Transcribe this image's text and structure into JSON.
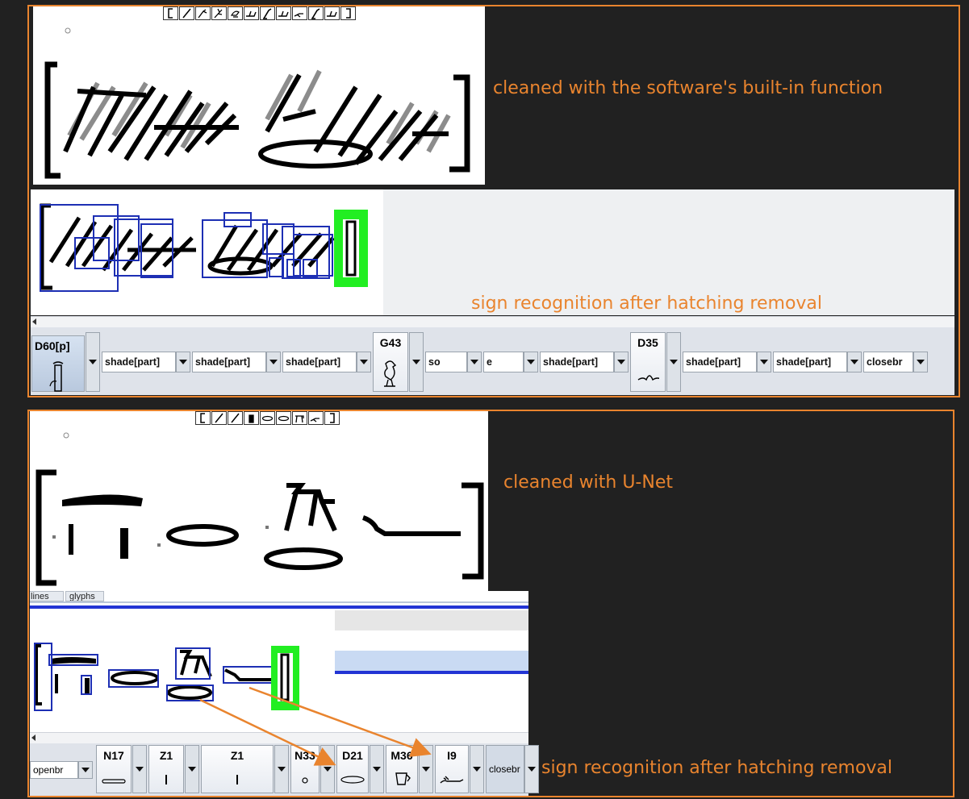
{
  "captions": {
    "top_cleaned": "cleaned with the software's built-in function",
    "top_recognition": "sign recognition after hatching removal",
    "bottom_cleaned": "cleaned with U-Net",
    "bottom_recognition": "sign recognition after hatching removal"
  },
  "colors": {
    "accent": "#e9842e",
    "background": "#212121",
    "box_blue": "#1d2fb4",
    "box_green": "#22ee22"
  },
  "top_panel": {
    "glyph_bar_icons": [
      "bracket-open-icon",
      "stroke-icon",
      "hand-icon",
      "flower-icon",
      "bird-icon",
      "arm-icon",
      "leg-icon",
      "arm-icon",
      "snake-icon",
      "leg-icon",
      "arm-icon",
      "bracket-close-icon"
    ],
    "sign_strip": [
      {
        "kind": "sign",
        "code": "D60[p]",
        "icon": "vase-water-icon",
        "selected": true
      },
      {
        "kind": "select",
        "label": "shade[part]"
      },
      {
        "kind": "select",
        "label": "shade[part]"
      },
      {
        "kind": "select",
        "label": "shade[part]"
      },
      {
        "kind": "sign",
        "code": "G43",
        "icon": "quail-chick-icon"
      },
      {
        "kind": "select",
        "label": "so"
      },
      {
        "kind": "select",
        "label": "e"
      },
      {
        "kind": "select",
        "label": "shade[part]"
      },
      {
        "kind": "sign",
        "code": "D35",
        "icon": "arms-negation-icon"
      },
      {
        "kind": "select",
        "label": "shade[part]"
      },
      {
        "kind": "select",
        "label": "shade[part]"
      },
      {
        "kind": "select",
        "label": "closebr"
      }
    ]
  },
  "bottom_panel": {
    "glyph_bar_icons": [
      "bracket-open-icon",
      "stroke-icon",
      "stroke-icon",
      "vase-icon",
      "mouth-icon",
      "mouth-icon",
      "stool-icon",
      "snake-icon",
      "bracket-close-icon"
    ],
    "tabs": [
      "lines",
      "glyphs"
    ],
    "sign_strip": {
      "openbr": "openbr",
      "signs": [
        {
          "code": "N17",
          "icon": "land-strip-icon"
        },
        {
          "code": "Z1",
          "icon": "stroke-icon"
        },
        {
          "code": "Z1",
          "icon": "stroke-icon"
        },
        {
          "code": "N33",
          "icon": "grain-icon"
        },
        {
          "code": "D21",
          "icon": "mouth-icon"
        },
        {
          "code": "M36",
          "icon": "flax-bundle-icon"
        },
        {
          "code": "I9",
          "icon": "horned-viper-icon"
        }
      ],
      "closebr": "closebr"
    }
  }
}
